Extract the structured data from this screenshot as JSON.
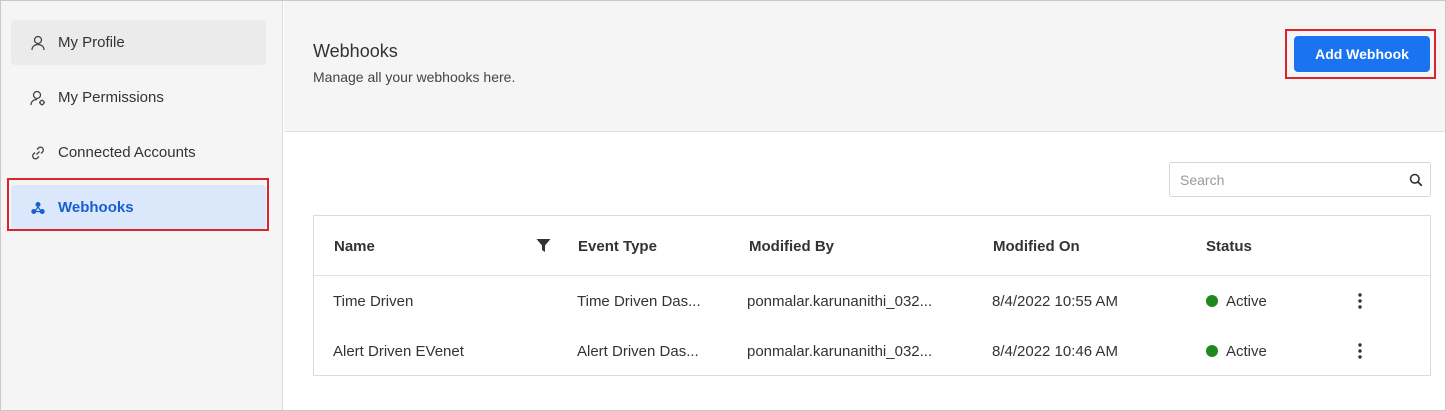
{
  "colors": {
    "accent": "#1a73f0",
    "active_bg": "#dbe8fb",
    "active_text": "#1a5fd0",
    "highlight_red": "#d9262c",
    "status_green": "#1e8a1e"
  },
  "sidebar": {
    "items": [
      {
        "label": "My Profile",
        "icon": "user-icon"
      },
      {
        "label": "My Permissions",
        "icon": "user-gear-icon"
      },
      {
        "label": "Connected Accounts",
        "icon": "link-icon"
      },
      {
        "label": "Webhooks",
        "icon": "webhook-icon",
        "active": true
      }
    ]
  },
  "header": {
    "title": "Webhooks",
    "subtitle": "Manage all your webhooks here.",
    "add_button": "Add Webhook"
  },
  "search": {
    "placeholder": "Search",
    "value": ""
  },
  "table": {
    "columns": [
      "Name",
      "Event Type",
      "Modified By",
      "Modified On",
      "Status"
    ],
    "rows": [
      {
        "name": "Time Driven",
        "event_type": "Time Driven Das...",
        "modified_by": "ponmalar.karunanithi_032...",
        "modified_on": "8/4/2022 10:55 AM",
        "status": "Active"
      },
      {
        "name": "Alert Driven EVenet",
        "event_type": "Alert Driven Das...",
        "modified_by": "ponmalar.karunanithi_032...",
        "modified_on": "8/4/2022 10:46 AM",
        "status": "Active"
      }
    ]
  }
}
